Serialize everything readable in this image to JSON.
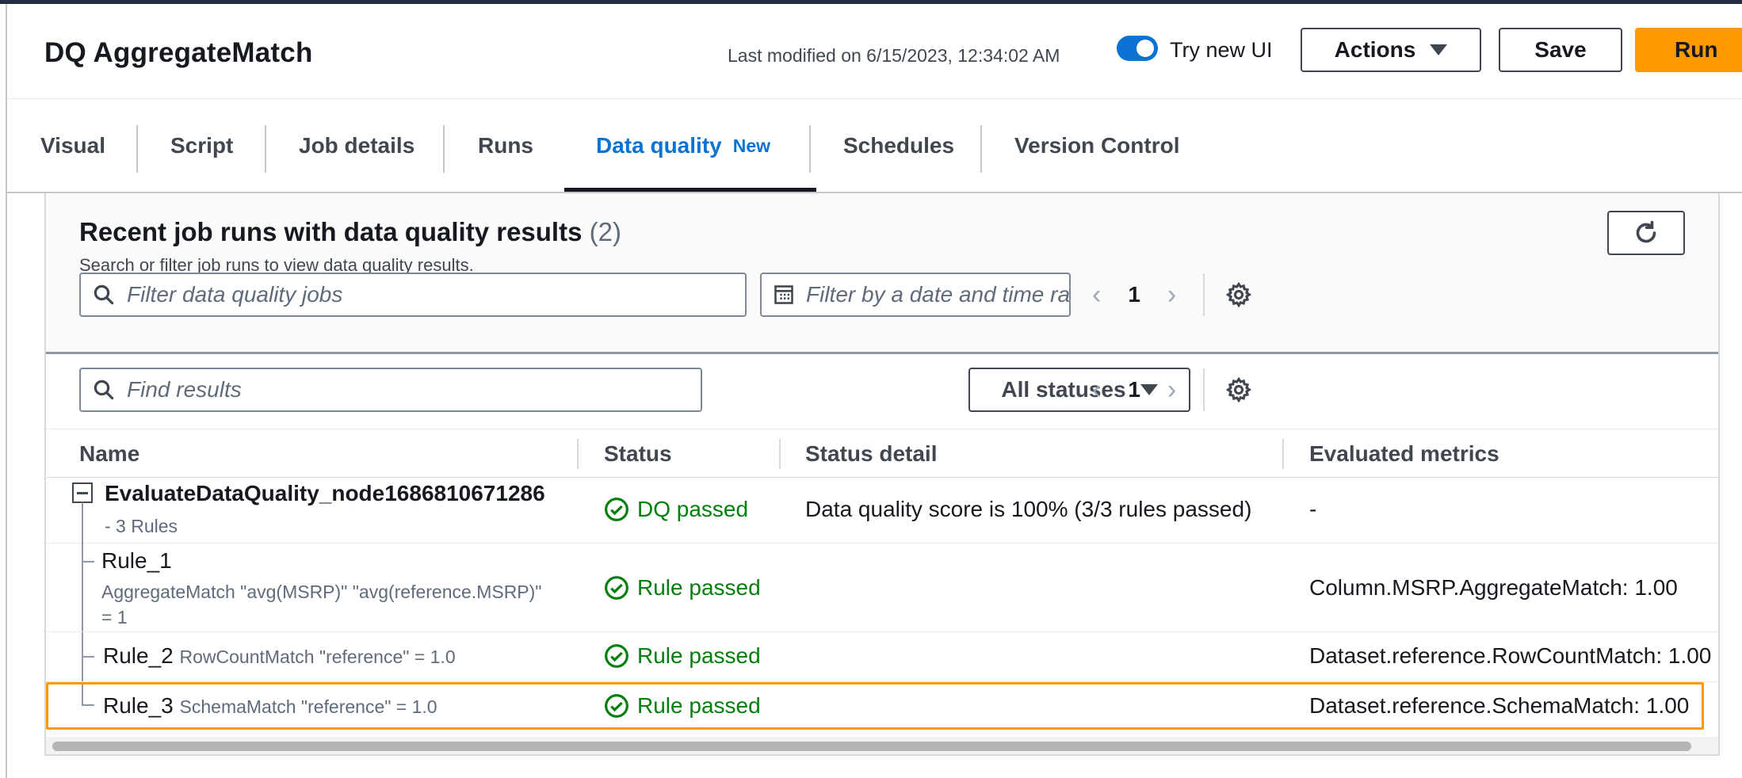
{
  "header": {
    "title": "DQ AggregateMatch",
    "last_modified": "Last modified on 6/15/2023, 12:34:02 AM",
    "toggle_label": "Try new UI",
    "actions_label": "Actions",
    "save_label": "Save",
    "run_label": "Run"
  },
  "tabs": [
    {
      "label": "Visual"
    },
    {
      "label": "Script"
    },
    {
      "label": "Job details"
    },
    {
      "label": "Runs"
    },
    {
      "label": "Data quality",
      "badge": "New",
      "active": true
    },
    {
      "label": "Schedules"
    },
    {
      "label": "Version Control"
    }
  ],
  "section": {
    "title": "Recent job runs with data quality results",
    "count": "(2)",
    "subtitle": "Search or filter job runs to view data quality results.",
    "filter_placeholder": "Filter data quality jobs",
    "date_placeholder": "Filter by a date and time range",
    "page": "1"
  },
  "results": {
    "find_placeholder": "Find results",
    "status_filter": "All statuses",
    "page": "1",
    "columns": [
      "Name",
      "Status",
      "Status detail",
      "Evaluated metrics"
    ],
    "rows": [
      {
        "name": "EvaluateDataQuality_node1686810671286",
        "sub": "- 3 Rules",
        "status": "DQ passed",
        "detail": "Data quality score is 100% (3/3 rules passed)",
        "metric": "-"
      },
      {
        "name": "Rule_1",
        "rule": "AggregateMatch \"avg(MSRP)\" \"avg(reference.MSRP)\"",
        "rule_tail": "= 1",
        "status": "Rule passed",
        "metric": "Column.MSRP.AggregateMatch: 1.00"
      },
      {
        "name": "Rule_2",
        "rule": "RowCountMatch \"reference\" = 1.0",
        "status": "Rule passed",
        "metric": "Dataset.reference.RowCountMatch: 1.00"
      },
      {
        "name": "Rule_3",
        "rule": "SchemaMatch \"reference\" = 1.0",
        "status": "Rule passed",
        "metric": "Dataset.reference.SchemaMatch: 1.00"
      }
    ]
  },
  "colors": {
    "accent": "#0972d3",
    "run_button": "#ff9900",
    "success": "#037f0c",
    "selection": "#ff9900"
  }
}
